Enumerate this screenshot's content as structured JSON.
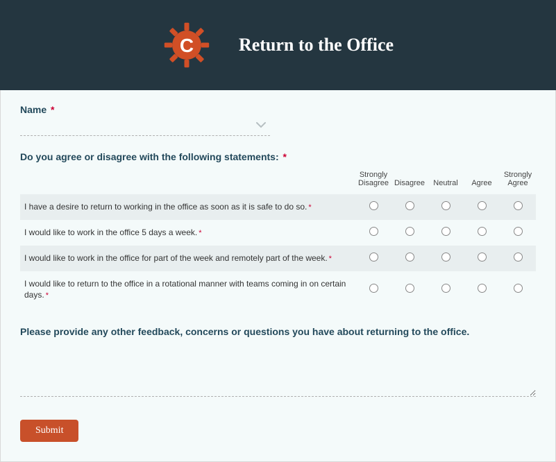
{
  "header": {
    "title": "Return to the Office",
    "logo_color": "#d14f26",
    "logo_letter": "C"
  },
  "name_field": {
    "label": "Name",
    "required_marker": "*",
    "value": ""
  },
  "matrix": {
    "question": "Do you agree or disagree with the following statements:",
    "required_marker": "*",
    "columns": [
      "Strongly Disagree",
      "Disagree",
      "Neutral",
      "Agree",
      "Strongly Agree"
    ],
    "rows": [
      {
        "text": "I have a desire to return to working in the office as soon as it is safe to do so.",
        "required": true
      },
      {
        "text": "I would like to work in the office 5 days a week.",
        "required": true
      },
      {
        "text": "I would like to work in the office for part of the week and remotely part of the week.",
        "required": true
      },
      {
        "text": "I would like to return to the office in a rotational manner with teams coming in on certain days.",
        "required": true
      }
    ]
  },
  "feedback": {
    "label": "Please provide any other feedback, concerns or questions you have about returning to the office.",
    "value": ""
  },
  "submit": {
    "label": "Submit"
  }
}
